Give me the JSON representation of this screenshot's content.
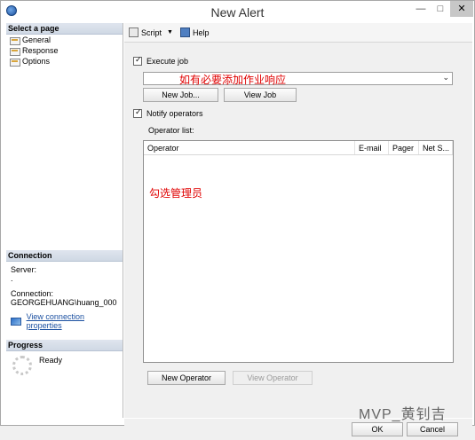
{
  "window": {
    "title": "New Alert",
    "controls": [
      "—",
      "□",
      "✕"
    ]
  },
  "left": {
    "select_page_header": "Select a page",
    "pages": [
      "General",
      "Response",
      "Options"
    ],
    "connection_header": "Connection",
    "server_label": "Server:",
    "server_value": ".",
    "connection_label": "Connection:",
    "connection_value": "GEORGEHUANG\\huang_000",
    "view_connection_link": "View connection properties",
    "progress_header": "Progress",
    "progress_status": "Ready"
  },
  "toolbar": {
    "script_label": "Script",
    "help_label": "Help"
  },
  "main": {
    "execute_job_label": "Execute job",
    "execute_job_checked": true,
    "job_annotation": "如有必要添加作业响应",
    "new_job_label": "New Job...",
    "view_job_label": "View Job",
    "notify_operators_label": "Notify operators",
    "notify_operators_checked": true,
    "operator_list_label": "Operator list:",
    "operator_columns": [
      "Operator",
      "E-mail",
      "Pager",
      "Net S..."
    ],
    "operator_annotation": "勾选管理员",
    "new_operator_label": "New Operator",
    "view_operator_label": "View Operator"
  },
  "footer": {
    "ok_label": "OK",
    "cancel_label": "Cancel",
    "watermark": "MVP_黄钊吉"
  }
}
